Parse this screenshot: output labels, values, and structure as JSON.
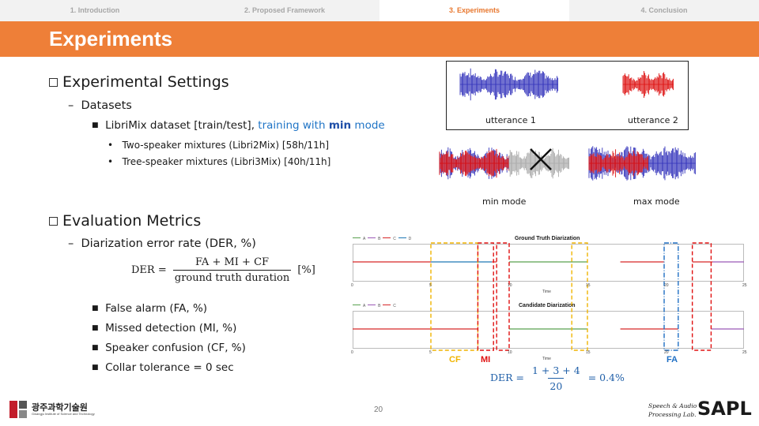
{
  "nav": {
    "tabs": [
      "1. Introduction",
      "2. Proposed Framework",
      "3. Experiments",
      "4. Conclusion"
    ],
    "active_index": 2
  },
  "title": "Experiments",
  "settings": {
    "heading": "Experimental Settings",
    "datasets": "Datasets",
    "librimix_prefix": "LibriMix dataset [train/test], ",
    "librimix_blue": "training with ",
    "librimix_bold": "min",
    "librimix_suffix": " mode",
    "two_speaker": "Two-speaker mixtures (Libri2Mix) [58h/11h]",
    "three_speaker": "Tree-speaker mixtures (Libri3Mix) [40h/11h]"
  },
  "metrics": {
    "heading": "Evaluation Metrics",
    "der": "Diarization error rate (DER, %)",
    "formula_lhs": "DER =",
    "formula_num": "FA + MI + CF",
    "formula_den": "ground truth duration",
    "formula_unit": "[%]",
    "items": [
      "False alarm (FA, %)",
      "Missed detection (MI, %)",
      "Speaker confusion (CF, %)",
      "Collar tolerance = 0 sec"
    ]
  },
  "waveforms": {
    "utterance1": "utterance 1",
    "utterance2": "utterance 2",
    "min_mode": "min mode",
    "max_mode": "max mode",
    "colors": {
      "utt1": "#3333bb",
      "utt2": "#dd1111",
      "muted": "#aaaaaa"
    }
  },
  "plots": {
    "gt_title": "Ground Truth Diarization",
    "cand_title": "Candidate Diarization",
    "time_label": "Time",
    "gt_legend": [
      "A",
      "B",
      "C",
      "D"
    ],
    "cand_legend": [
      "A",
      "B",
      "C"
    ],
    "ticks": [
      "0",
      "5",
      "10",
      "15",
      "20",
      "25"
    ],
    "colors": {
      "A": "#59a14f",
      "B": "#9b59b6",
      "C": "#d62728",
      "D": "#1f77b4"
    }
  },
  "error_labels": {
    "cf": "CF",
    "mi": "MI",
    "fa": "FA",
    "colors": {
      "cf": "#f0b400",
      "mi": "#e01010",
      "fa": "#1f6fc4"
    }
  },
  "example": {
    "lhs": "DER =",
    "num": "1 + 3 + 4",
    "den": "20",
    "rhs": "= 0.4%"
  },
  "footer": {
    "page": "20",
    "logo_left": "광주과학기술원",
    "logo_left_sub": "Gwangju Institute of Science and Technology",
    "lab_line1": "Speech & Audio",
    "lab_line2": "Processing Lab.",
    "lab_logo": "SAPL"
  }
}
